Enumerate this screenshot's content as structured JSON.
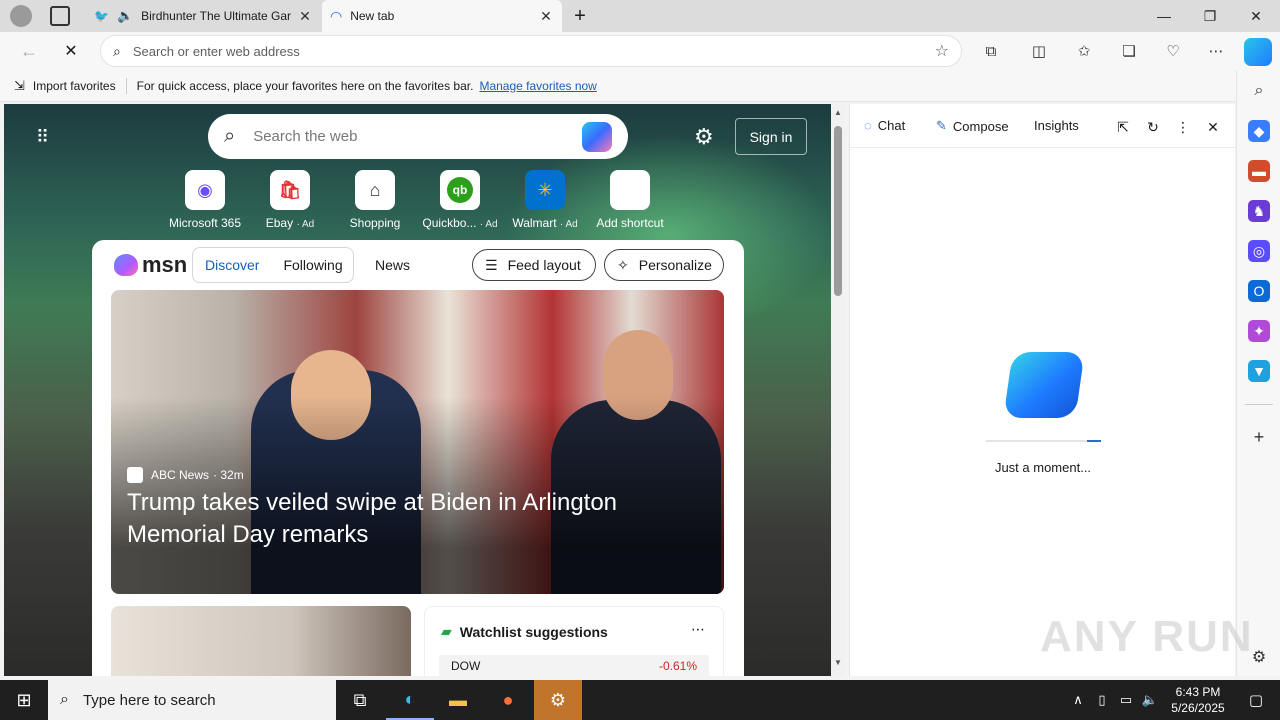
{
  "tabs": [
    {
      "title": "Birdhunter The Ultimate Gar",
      "active": false
    },
    {
      "title": "New tab",
      "active": true
    }
  ],
  "address": {
    "placeholder": "Search or enter web address"
  },
  "favorites_bar": {
    "import_label": "Import favorites",
    "hint": "For quick access, place your favorites here on the favorites bar.",
    "manage_link": "Manage favorites now"
  },
  "ntp": {
    "search_placeholder": "Search the web",
    "signin_label": "Sign in",
    "shortcuts": [
      {
        "label": "Microsoft 365",
        "ad": "",
        "icon": "microsoft-365-icon"
      },
      {
        "label": "Ebay",
        "ad": "· Ad",
        "icon": "ebay-icon"
      },
      {
        "label": "Shopping",
        "ad": "",
        "icon": "tag-icon"
      },
      {
        "label": "Quickbo...",
        "ad": "· Ad",
        "icon": "quickbooks-icon"
      },
      {
        "label": "Walmart",
        "ad": "· Ad",
        "icon": "walmart-icon"
      },
      {
        "label": "Add shortcut",
        "ad": "",
        "icon": "plus-icon"
      }
    ]
  },
  "feed": {
    "brand": "msn",
    "tabs": [
      "Discover",
      "Following"
    ],
    "news_link": "News",
    "feed_layout_label": "Feed layout",
    "personalize_label": "Personalize",
    "hero": {
      "source": "ABC News",
      "age": "· 32m",
      "headline": "Trump takes veiled swipe at Biden in Arlington Memorial Day remarks"
    },
    "watchlist": {
      "title": "Watchlist suggestions",
      "rows": [
        {
          "symbol": "DOW",
          "change": "-0.61%"
        }
      ]
    }
  },
  "copilot_panel": {
    "tabs": [
      "Chat",
      "Compose",
      "Insights"
    ],
    "status": "Just a moment..."
  },
  "watermark": "ANY RUN",
  "taskbar": {
    "search_placeholder": "Type here to search",
    "time": "6:43 PM",
    "date": "5/26/2025"
  },
  "colors": {
    "accent": "#2b6cd1",
    "taskbar": "#1f1f1f",
    "taskbar_active": "#c0752b",
    "negative": "#c62828"
  }
}
